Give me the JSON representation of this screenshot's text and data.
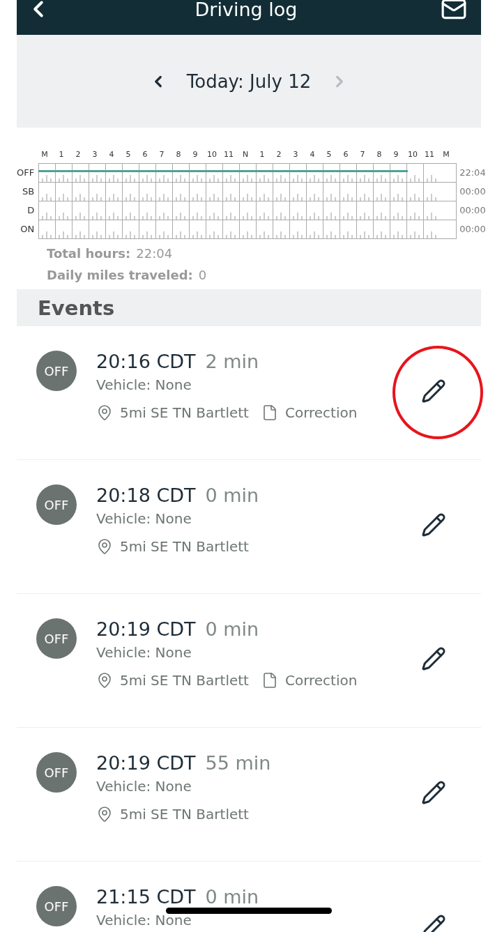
{
  "header": {
    "title": "Driving log"
  },
  "date_nav": {
    "label": "Today: July 12",
    "prev_disabled": false,
    "next_disabled": true
  },
  "duty_graph": {
    "hours": [
      "M",
      "1",
      "2",
      "3",
      "4",
      "5",
      "6",
      "7",
      "8",
      "9",
      "10",
      "11",
      "N",
      "1",
      "2",
      "3",
      "4",
      "5",
      "6",
      "7",
      "8",
      "9",
      "10",
      "11",
      "M"
    ],
    "rows": [
      {
        "label": "OFF",
        "level": 0.92,
        "total": "22:04"
      },
      {
        "label": "SB",
        "total": "00:00"
      },
      {
        "label": "D",
        "total": "00:00"
      },
      {
        "label": "ON",
        "total": "00:00"
      }
    ]
  },
  "summary": [
    {
      "label": "Total hours:",
      "value": "22:04"
    },
    {
      "label": "Daily miles traveled:",
      "value": "0"
    }
  ],
  "events_title": "Events",
  "events": [
    {
      "status": "OFF",
      "time": "20:16 CDT",
      "duration": "2 min",
      "vehicle": "Vehicle: None",
      "location": "5mi SE TN Bartlett",
      "note": "Correction",
      "circled": true
    },
    {
      "status": "OFF",
      "time": "20:18 CDT",
      "duration": "0 min",
      "vehicle": "Vehicle: None",
      "location": "5mi SE TN Bartlett"
    },
    {
      "status": "OFF",
      "time": "20:19 CDT",
      "duration": "0 min",
      "vehicle": "Vehicle: None",
      "location": "5mi SE TN Bartlett",
      "note": "Correction"
    },
    {
      "status": "OFF",
      "time": "20:19 CDT",
      "duration": "55 min",
      "vehicle": "Vehicle: None",
      "location": "5mi SE TN Bartlett"
    },
    {
      "status": "OFF",
      "time": "21:15 CDT",
      "duration": "0 min",
      "vehicle": "Vehicle: None"
    }
  ]
}
